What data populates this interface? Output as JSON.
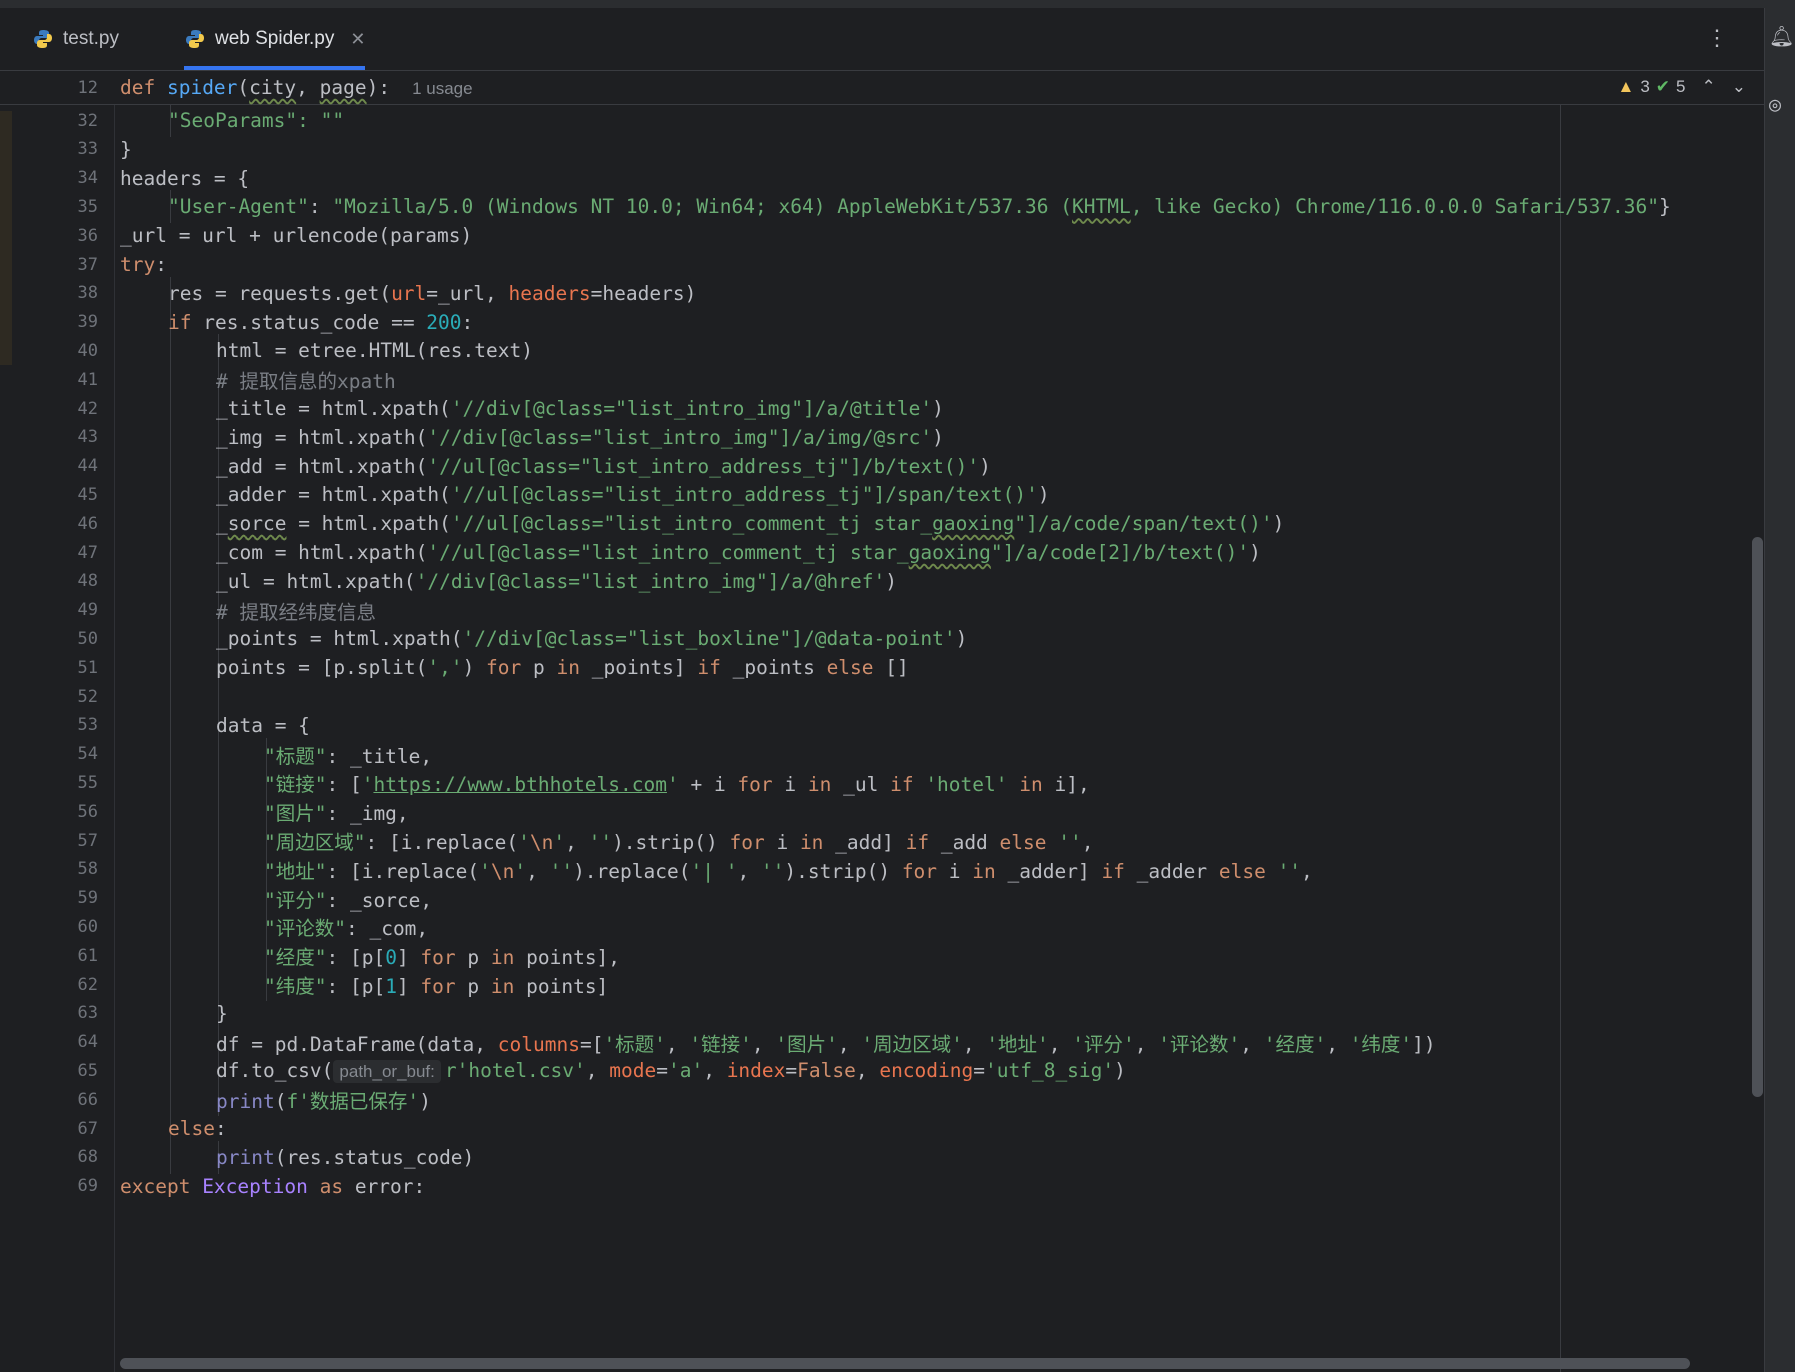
{
  "tabs": [
    {
      "label": "test.py",
      "icon": "python-icon"
    },
    {
      "label": "web Spider.py",
      "icon": "python-icon",
      "active": true
    }
  ],
  "toolbar": {
    "menu_icon": "more-vertical-icon",
    "right_icons": [
      "notifications-icon",
      "ai-assistant-icon"
    ]
  },
  "inspections": {
    "warnings": "3",
    "ok": "5"
  },
  "sticky_header": {
    "line_number": "12",
    "usage_hint": "1 usage"
  },
  "lines": [
    {
      "n": "32"
    },
    {
      "n": "33"
    },
    {
      "n": "34"
    },
    {
      "n": "35"
    },
    {
      "n": "36"
    },
    {
      "n": "37"
    },
    {
      "n": "38"
    },
    {
      "n": "39"
    },
    {
      "n": "40"
    },
    {
      "n": "41"
    },
    {
      "n": "42"
    },
    {
      "n": "43"
    },
    {
      "n": "44"
    },
    {
      "n": "45"
    },
    {
      "n": "46"
    },
    {
      "n": "47"
    },
    {
      "n": "48"
    },
    {
      "n": "49"
    },
    {
      "n": "50"
    },
    {
      "n": "51"
    },
    {
      "n": "52"
    },
    {
      "n": "53"
    },
    {
      "n": "54"
    },
    {
      "n": "55"
    },
    {
      "n": "56"
    },
    {
      "n": "57"
    },
    {
      "n": "58"
    },
    {
      "n": "59"
    },
    {
      "n": "60"
    },
    {
      "n": "61"
    },
    {
      "n": "62"
    },
    {
      "n": "63"
    },
    {
      "n": "64"
    },
    {
      "n": "65"
    },
    {
      "n": "66"
    },
    {
      "n": "67"
    },
    {
      "n": "68"
    },
    {
      "n": "69"
    }
  ],
  "param_hint": "path_or_buf:",
  "code_text": {
    "l12": [
      "def ",
      "spider",
      "(",
      "city",
      ", ",
      "page",
      "):"
    ],
    "l32": "\"SeoParams\": \"\"",
    "l33": "}",
    "l34": "headers = {",
    "l35": [
      "\"User-Agent\"",
      ": ",
      "\"Mozilla/5.0 (Windows NT 10.0; Win64; x64) AppleWebKit/537.36 (",
      "KHTML",
      ", like Gecko) Chrome/116.0.0.0 Safari/537.36\"",
      "}"
    ],
    "l36": "_url = url + urlencode(params)",
    "l37": [
      "try",
      ":"
    ],
    "l38": [
      "res = requests.get(",
      "url",
      "=_url, ",
      "headers",
      "=headers)"
    ],
    "l39": [
      "if ",
      "res.status_code == ",
      "200",
      ":"
    ],
    "l40": "html = etree.HTML(res.text)",
    "l41": "# 提取信息的xpath",
    "l42": [
      "_title = html.xpath(",
      "'//div[@class=\"list_intro_img\"]/a/@title'",
      ")"
    ],
    "l43": [
      "_img = html.xpath(",
      "'//div[@class=\"list_intro_img\"]/a/img/@src'",
      ")"
    ],
    "l44": [
      "_add = html.xpath(",
      "'//ul[@class=\"list_intro_address_tj\"]/b/text()'",
      ")"
    ],
    "l45": [
      "_adder = html.xpath(",
      "'//ul[@class=\"list_intro_address_tj\"]/span/text()'",
      ")"
    ],
    "l46": [
      "_",
      "sorce",
      " = html.xpath(",
      "'//ul[@class=\"list_intro_comment_tj star_",
      "gaoxing",
      "\"]/a/code/span/text()'",
      ")"
    ],
    "l47": [
      "_com = html.xpath(",
      "'//ul[@class=\"list_intro_comment_tj star_",
      "gaoxing",
      "\"]/a/code[2]/b/text()'",
      ")"
    ],
    "l48": [
      "_ul = html.xpath(",
      "'//div[@class=\"list_intro_img\"]/a/@href'",
      ")"
    ],
    "l49": "# 提取经纬度信息",
    "l50": [
      "_points = html.xpath(",
      "'//div[@class=\"list_boxline\"]/@data-point'",
      ")"
    ],
    "l51": [
      "points = [p.split(",
      "','",
      ") ",
      "for",
      " p ",
      "in",
      " _points] ",
      "if",
      " _points ",
      "else",
      " []"
    ],
    "l52": "",
    "l53": "data = {",
    "l54": [
      "\"标题\"",
      ": _title,"
    ],
    "l55": [
      "\"链接\"",
      ": [",
      "'",
      "https://www.bthhotels.com",
      "'",
      " + i ",
      "for",
      " i ",
      "in",
      " _ul ",
      "if",
      " ",
      "'hotel'",
      " ",
      "in",
      " i],"
    ],
    "l56": [
      "\"图片\"",
      ": _img,"
    ],
    "l57": [
      "\"周边区域\"",
      ": [i.replace(",
      "'",
      "\\n",
      "'",
      ", ",
      "''",
      ").strip() ",
      "for",
      " i ",
      "in",
      " _add] ",
      "if",
      " _add ",
      "else",
      " ",
      "''",
      ","
    ],
    "l58": [
      "\"地址\"",
      ": [i.replace(",
      "'",
      "\\n",
      "'",
      ", ",
      "''",
      ").replace(",
      "'| '",
      ", ",
      "''",
      ").strip() ",
      "for",
      " i ",
      "in",
      " _adder] ",
      "if",
      " _adder ",
      "else",
      " ",
      "''",
      ","
    ],
    "l59": [
      "\"评分\"",
      ": _sorce,"
    ],
    "l60": [
      "\"评论数\"",
      ": _com,"
    ],
    "l61": [
      "\"经度\"",
      ": [p[",
      "0",
      "] ",
      "for",
      " p ",
      "in",
      " points],"
    ],
    "l62": [
      "\"纬度\"",
      ": [p[",
      "1",
      "] ",
      "for",
      " p ",
      "in",
      " points]"
    ],
    "l63": "}",
    "l64": [
      "df = pd.DataFrame(data, ",
      "columns",
      "=[",
      "'标题'",
      ", ",
      "'链接'",
      ", ",
      "'图片'",
      ", ",
      "'周边区域'",
      ", ",
      "'地址'",
      ", ",
      "'评分'",
      ", ",
      "'评论数'",
      ", ",
      "'经度'",
      ", ",
      "'纬度'",
      "])"
    ],
    "l65": [
      "df.to_csv(",
      "r'hotel.csv'",
      ", ",
      "mode",
      "=",
      "'a'",
      ", ",
      "index",
      "=",
      "False",
      ", ",
      "encoding",
      "=",
      "'utf_8_sig'",
      ")"
    ],
    "l66": [
      "print",
      "(",
      "f'数据已保存'",
      ")"
    ],
    "l67": [
      "else",
      ":"
    ],
    "l68": [
      "print",
      "(res.status_code)"
    ],
    "l69": [
      "except ",
      "Exception",
      " as ",
      "error:"
    ]
  }
}
